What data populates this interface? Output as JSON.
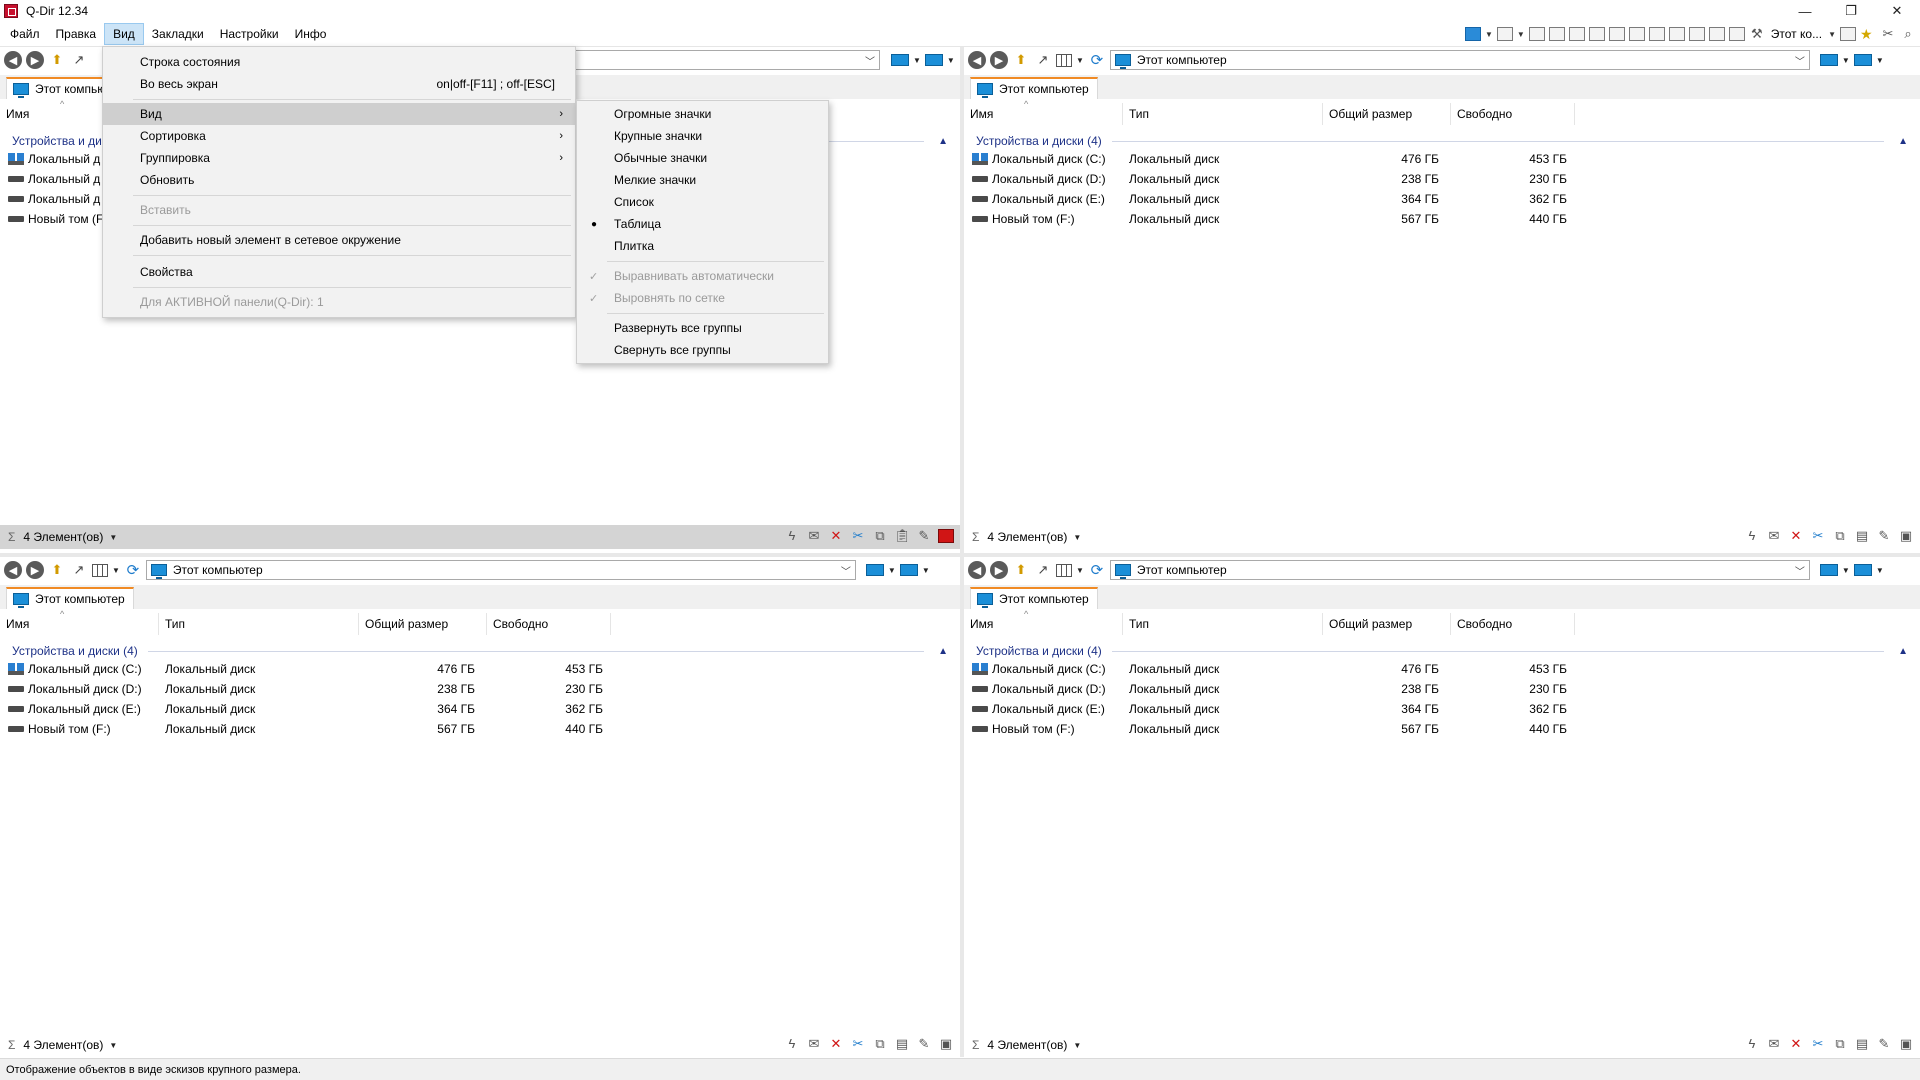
{
  "window": {
    "title": "Q-Dir 12.34",
    "minimize": "—",
    "restore": "❐",
    "close": "✕"
  },
  "menubar": {
    "items": [
      "Файл",
      "Правка",
      "Вид",
      "Закладки",
      "Настройки",
      "Инфо"
    ],
    "right_label": "Этот ко..."
  },
  "view_menu": {
    "items": [
      {
        "label": "Строка состояния"
      },
      {
        "label": "Во весь экран",
        "shortcut": "on|off-[F11] ; off-[ESC]"
      },
      {
        "label": "Вид"
      },
      {
        "label": "Сортировка"
      },
      {
        "label": "Группировка"
      },
      {
        "label": "Обновить"
      },
      {
        "label": "Вставить"
      },
      {
        "label": "Добавить новый элемент в сетевое окружение"
      },
      {
        "label": "Свойства"
      },
      {
        "label": "Для АКТИВНОЙ панели(Q-Dir): 1"
      }
    ]
  },
  "submenu": {
    "items": [
      "Огромные значки",
      "Крупные значки",
      "Обычные значки",
      "Мелкие значки",
      "Список",
      "Таблица",
      "Плитка",
      "Выравнивать автоматически",
      "Выровнять по сетке",
      "Развернуть все группы",
      "Свернуть все группы"
    ],
    "selected": "Таблица"
  },
  "pane": {
    "address": "Этот компьютер",
    "tab": "Этот компьютер",
    "columns": [
      "Имя",
      "Тип",
      "Общий размер",
      "Свободно"
    ],
    "group": "Устройства и диски (4)",
    "status": "4 Элемент(ов)",
    "rows": [
      {
        "name": "Локальный диск (C:)",
        "type": "Локальный диск",
        "total": "476 ГБ",
        "free": "453 ГБ"
      },
      {
        "name": "Локальный диск (D:)",
        "type": "Локальный диск",
        "total": "238 ГБ",
        "free": "230 ГБ"
      },
      {
        "name": "Локальный диск (E:)",
        "type": "Локальный диск",
        "total": "364 ГБ",
        "free": "362 ГБ"
      },
      {
        "name": "Новый том (F:)",
        "type": "Локальный диск",
        "total": "567 ГБ",
        "free": "440 ГБ"
      }
    ]
  },
  "pane1_truncated": {
    "tab": "Этот компью",
    "group": "Устройства и ди",
    "rows": [
      "Локальный д",
      "Локальный д",
      "Локальный д",
      "Новый том (F"
    ]
  },
  "bottom_status": "Отображение объектов в виде эскизов крупного размера."
}
